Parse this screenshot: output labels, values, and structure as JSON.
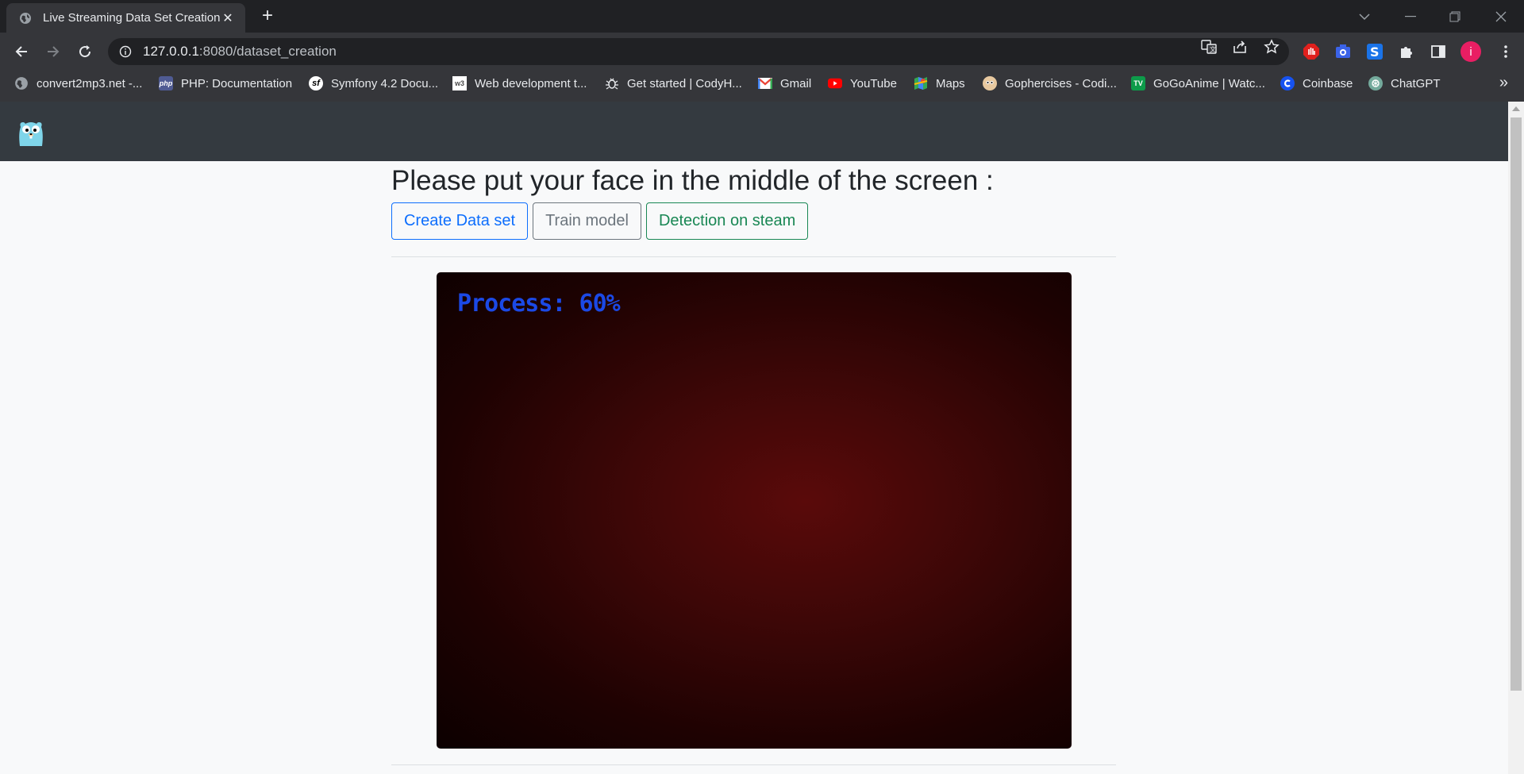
{
  "browser": {
    "tab": {
      "title": "Live Streaming Data Set Creation",
      "close": "✕"
    },
    "new_tab": "+",
    "url": {
      "host": "127.0.0.1",
      "rest": ":8080/dataset_creation"
    },
    "bookmarks": [
      {
        "label": "convert2mp3.net -...",
        "icon": "globe-icon",
        "color": "#5f6368"
      },
      {
        "label": "PHP: Documentation",
        "icon": "php-icon",
        "color": "#4f5b93"
      },
      {
        "label": "Symfony 4.2 Docu...",
        "icon": "symfony-icon",
        "color": "#ffffff"
      },
      {
        "label": "Web development t...",
        "icon": "w3schools-icon",
        "color": "#ffffff"
      },
      {
        "label": "Get started | CodyH...",
        "icon": "bug-icon",
        "color": "#35363a"
      },
      {
        "label": "Gmail",
        "icon": "gmail-icon",
        "color": "#ffffff"
      },
      {
        "label": "YouTube",
        "icon": "youtube-icon",
        "color": "#ff0000"
      },
      {
        "label": "Maps",
        "icon": "maps-icon",
        "color": "#34a853"
      },
      {
        "label": "Gophercises - Codi...",
        "icon": "gopher-icon",
        "color": "#e8c9a0"
      },
      {
        "label": "GoGoAnime | Watc...",
        "icon": "gogoanime-icon",
        "color": "#0d9b4a"
      },
      {
        "label": "Coinbase",
        "icon": "coinbase-icon",
        "color": "#1652f0"
      },
      {
        "label": "ChatGPT",
        "icon": "chatgpt-icon",
        "color": "#74aa9c"
      }
    ],
    "bookmarks_overflow": "»",
    "profile_initial": "i"
  },
  "page": {
    "heading": "Please put your face in the middle of the screen :",
    "buttons": {
      "create": "Create Data set",
      "train": "Train model",
      "detect": "Detection on steam"
    },
    "stream_overlay": "Process: 60%",
    "progress": 60
  }
}
